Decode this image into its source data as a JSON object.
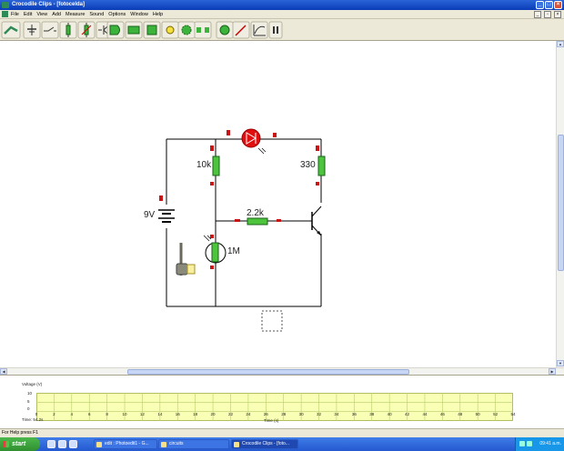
{
  "window": {
    "title": "Crocodile Clips - [fotocelda]"
  },
  "menu": {
    "items": [
      "File",
      "Edit",
      "View",
      "Add",
      "Measure",
      "Sound",
      "Options",
      "Window",
      "Help"
    ]
  },
  "toolbar": {
    "tools": [
      "wire-tool",
      "power-supply-tool",
      "switch-tool",
      "resistor-tool",
      "sensor-tool",
      "diode-tool",
      "transistor-tool",
      "logic-gate-tool",
      "ic-chip-tool",
      "output-device-tool",
      "speaker-tool",
      "lamp-tool",
      "gear-tool",
      "connector-tool",
      "motor-tool",
      "probe-tool",
      "graph-tool",
      "pause-tool"
    ]
  },
  "circuit": {
    "battery_label": "9V",
    "r1_label": "10k",
    "r2_label": "330",
    "r3_label": "2.2k",
    "ldr_label": "1M"
  },
  "graph": {
    "y_label": "Voltage (V)",
    "y_ticks": [
      "10",
      "5",
      "0"
    ],
    "x_ticks": [
      "0",
      "2",
      "4",
      "6",
      "8",
      "10",
      "12",
      "14",
      "16",
      "18",
      "20",
      "22",
      "24",
      "26",
      "28",
      "30",
      "32",
      "34",
      "36",
      "38",
      "40",
      "42",
      "44",
      "46",
      "48",
      "50",
      "52",
      "54"
    ],
    "x_label": "Time (s)",
    "time_readout": "Time: 54.2s",
    "plot_color": "#f9ffb4"
  },
  "status": {
    "text": "For Help press F1"
  },
  "taskbar": {
    "start_label": "start",
    "tasks": [
      "edit : Photoedit1 - G...",
      "circuits",
      "Crocodile Clips - [foto..."
    ],
    "clock": "09:41 a.m."
  }
}
